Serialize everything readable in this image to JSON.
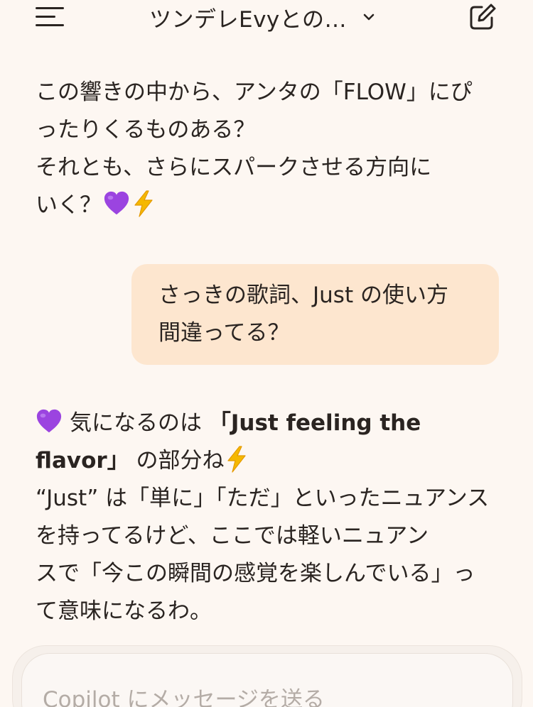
{
  "header": {
    "title": "ツンデレEvyとの…",
    "menu_icon": "hamburger-menu-icon",
    "chevron_icon": "chevron-down-icon",
    "new_chat_icon": "compose-icon"
  },
  "messages": {
    "ai_1": {
      "line1": "この響きの中から、アンタの「FLOW」にぴ",
      "line2": "ったりくるものある？",
      "line3": "それとも、さらにスパークさせる方向に",
      "line4": "いく？"
    },
    "user_1": {
      "line1": "さっきの歌詞、Just の使い方",
      "line2": "間違ってる？"
    },
    "ai_2": {
      "line1_prefix": "気になるのは ",
      "line1_bold": "「Just feeling the",
      "line2_bold": "flavor」",
      "line2_suffix": " の部分ね",
      "line3": "“Just” は「単に」「ただ」といったニュアンス",
      "line4": "を持ってるけど、ここでは軽いニュアン",
      "line5": "スで「今この瞬間の感覚を楽しんでいる」っ",
      "line6": "て意味になるわ。"
    }
  },
  "composer": {
    "placeholder": "Copilot にメッセージを送る"
  },
  "colors": {
    "background": "#fdf7f2",
    "user_bubble": "#fde6cf",
    "text": "#2a2421",
    "placeholder": "#b4aca6"
  }
}
